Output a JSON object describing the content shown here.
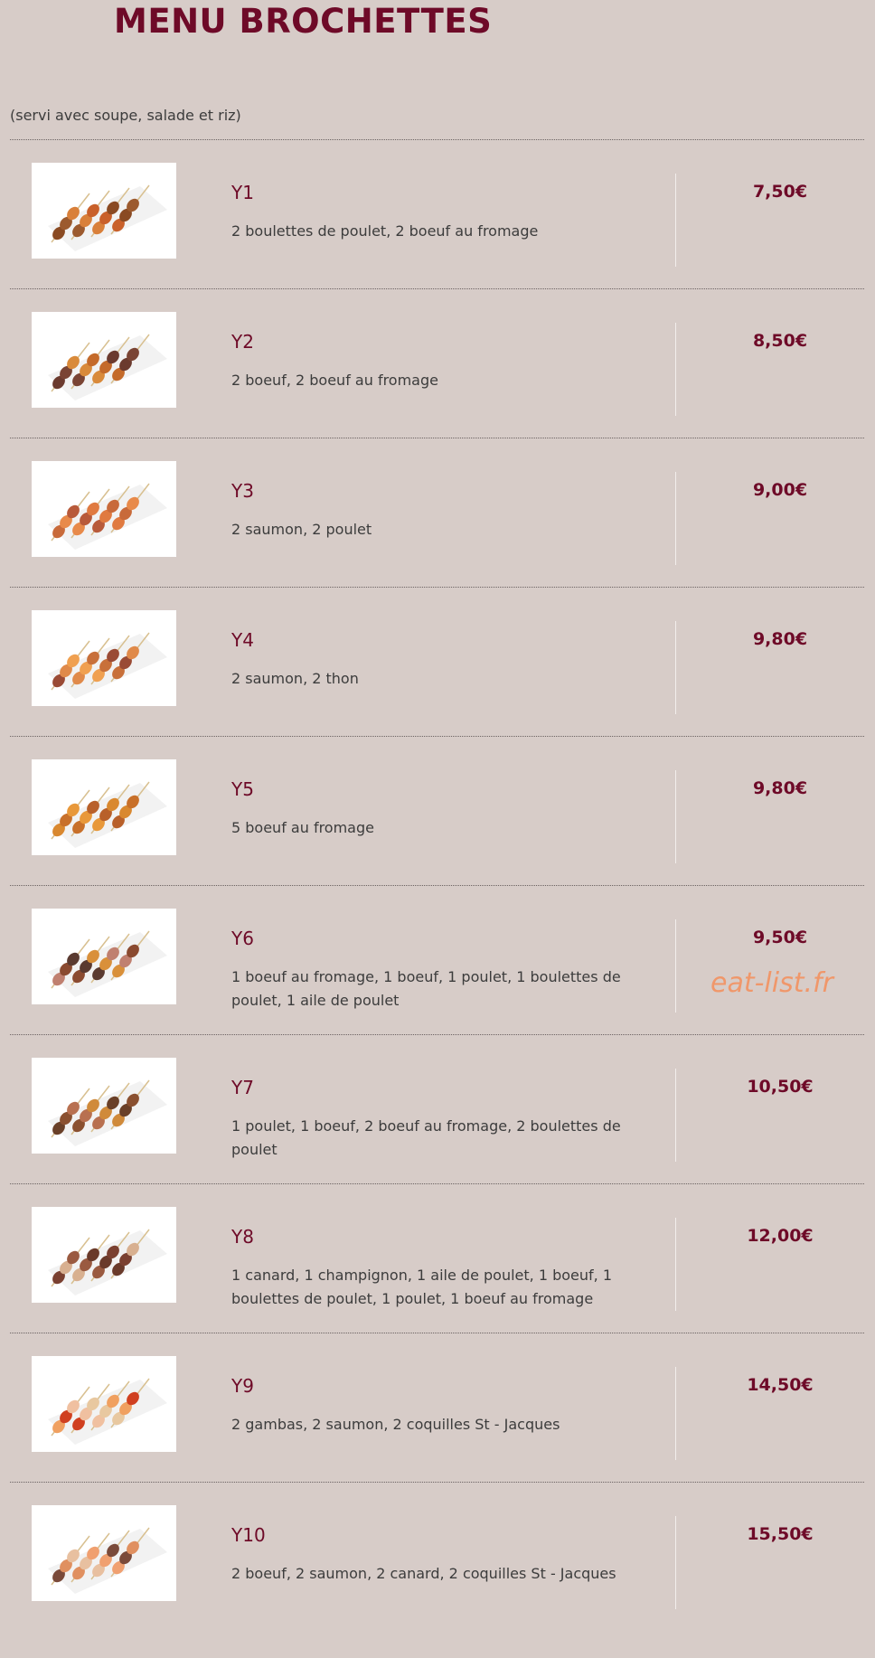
{
  "page": {
    "title": "MENU BROCHETTES",
    "subtitle": "(servi avec soupe, salade et riz)",
    "watermark": "eat-list.fr"
  },
  "colors": {
    "background": "#d7ccc8",
    "accent": "#6e0a28",
    "watermark": "#f0976a"
  },
  "items": [
    {
      "code": "Y1",
      "description": "2 boulettes de poulet, 2 boeuf au fromage",
      "price": "7,50€",
      "image": "skewer-photo-meatballs-cheese-beef"
    },
    {
      "code": "Y2",
      "description": "2 boeuf, 2 boeuf au fromage",
      "price": "8,50€",
      "image": "skewer-photo-beef-cheese-beef"
    },
    {
      "code": "Y3",
      "description": "2 saumon, 2 poulet",
      "price": "9,00€",
      "image": "skewer-photo-salmon-chicken"
    },
    {
      "code": "Y4",
      "description": "2 saumon, 2 thon",
      "price": "9,80€",
      "image": "skewer-photo-salmon-tuna"
    },
    {
      "code": "Y5",
      "description": "5 boeuf au fromage",
      "price": "9,80€",
      "image": "skewer-photo-cheese-beef"
    },
    {
      "code": "Y6",
      "description": "1 boeuf au fromage, 1 boeuf, 1 poulet, 1 boulettes de poulet, 1 aile de poulet",
      "price": "9,50€",
      "image": "skewer-photo-mixed"
    },
    {
      "code": "Y7",
      "description": "1 poulet, 1 boeuf, 2 boeuf au fromage, 2 boulettes de poulet",
      "price": "10,50€",
      "image": "skewer-photo-mixed-meatballs"
    },
    {
      "code": "Y8",
      "description": "1 canard, 1 champignon, 1 aile de poulet, 1 boeuf, 1 boulettes de poulet, 1 poulet, 1 boeuf au fromage",
      "price": "12,00€",
      "image": "skewer-photo-assorted"
    },
    {
      "code": "Y9",
      "description": "2 gambas, 2 saumon, 2 coquilles St - Jacques",
      "price": "14,50€",
      "image": "skewer-photo-seafood"
    },
    {
      "code": "Y10",
      "description": "2 boeuf, 2 saumon, 2 canard, 2 coquilles St - Jacques",
      "price": "15,50€",
      "image": "skewer-photo-mixed-seafood"
    }
  ]
}
